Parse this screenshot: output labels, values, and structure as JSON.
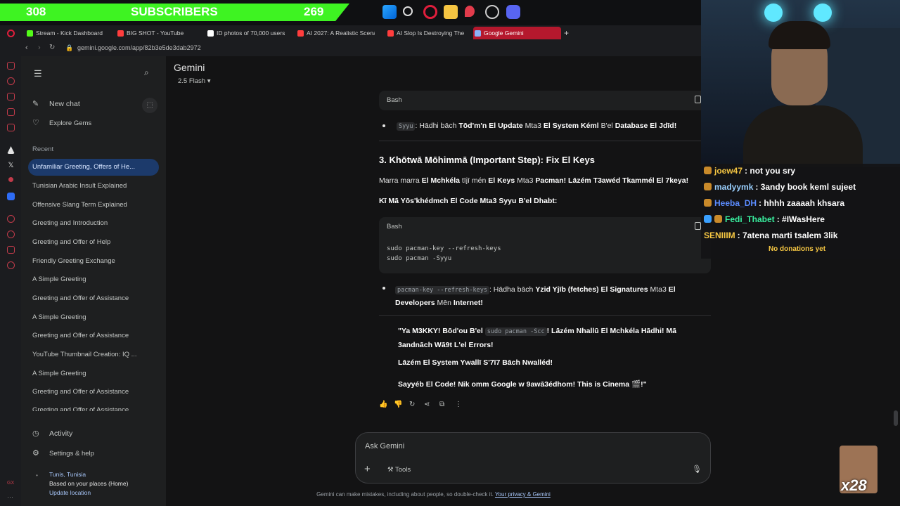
{
  "overlay": {
    "subscribers_left": "308",
    "subscribers_label": "SUBSCRIBERS",
    "subscribers_right": "269",
    "chat": [
      {
        "user": "joew47",
        "message": ": not you sry",
        "color": "#f6c743"
      },
      {
        "user": "madyymk",
        "message": ": 3andy book keml sujeet",
        "color": "#9ad0ff"
      },
      {
        "user": "Heeba_DH",
        "message": ": hhhh zaaaah khsara",
        "color": "#5b8cff"
      },
      {
        "user": "Fedi_Thabet",
        "message": ": #IWasHere",
        "color": "#39f0a0"
      },
      {
        "user": "SENIIIM",
        "message": ": 7atena marti tsalem 3lik",
        "color": "#f6c743"
      }
    ],
    "no_donations": "No donations yet",
    "emote_multiplier": "x28"
  },
  "browser": {
    "tabs": [
      {
        "label": "Stream - Kick Dashboard",
        "color": "#53fc18"
      },
      {
        "label": "BIG SHOT - YouTube",
        "color": "#ff3d3d"
      },
      {
        "label": "ID photos of 70,000 users",
        "color": "#ffffff"
      },
      {
        "label": "AI 2027: A Realistic Scena",
        "color": "#ff3d3d"
      },
      {
        "label": "AI Slop Is Destroying The",
        "color": "#ff3d3d"
      },
      {
        "label": "Google Gemini",
        "color": "#ffffff"
      }
    ],
    "url": "gemini.google.com/app/82b3e5de3dab2972"
  },
  "sidebar": {
    "new_chat": "New chat",
    "explore_gems": "Explore Gems",
    "recent_title": "Recent",
    "recent": [
      "Unfamiliar Greeting, Offers of He...",
      "Tunisian Arabic Insult Explained",
      "Offensive Slang Term Explained",
      "Greeting and Introduction",
      "Greeting and Offer of Help",
      "Friendly Greeting Exchange",
      "A Simple Greeting",
      "Greeting and Offer of Assistance",
      "A Simple Greeting",
      "Greeting and Offer of Assistance",
      "YouTube Thumbnail Creation: IQ ...",
      "A Simple Greeting",
      "Greeting and Offer of Assistance",
      "Greeting and Offer of Assistance"
    ],
    "activity": "Activity",
    "settings": "Settings & help",
    "location": "Tunis, Tunisia",
    "location_basis": "Based on your places (Home)",
    "update_location": "Update location"
  },
  "main": {
    "title": "Gemini",
    "model": "2.5 Flash",
    "code1_lang": "Bash",
    "bullet1_code": "Syyu",
    "bullet1_pre": ": Hādhi bāch ",
    "bullet1_b1": "Tōd'm'n El Update",
    "bullet1_mid": " Mta3 ",
    "bullet1_b2": "El System Kéml",
    "bullet1_mid2": " B'el ",
    "bullet1_b3": "Database El Jdīd!",
    "heading": "3. Khōtwā Mōhimmā (Important Step): Fix El Keys",
    "para1_pre": "Marra marra ",
    "para1_b1": "El Mchkéla",
    "para1_mid": " tījī mén ",
    "para1_b2": "El Keys",
    "para1_mid2": " Mta3 ",
    "para1_b3": "Pacman! Lāzém T3awéd Tkammél El 7keya!",
    "para2": "Kī Mā Yōs'khédmch El Code Mta3 Syyu B'el Dhabt:",
    "code2_lang": "Bash",
    "code2_line1": "sudo pacman-key --refresh-keys",
    "code2_line2": "sudo pacman -Syyu",
    "bullet2_code": "pacman-key --refresh-keys",
    "bullet2_pre": ": Hādha bāch ",
    "bullet2_b1": "Yzid Yjīb (fetches) El Signatures",
    "bullet2_mid": " Mta3 ",
    "bullet2_b2": "El Developers",
    "bullet2_mid2": " Mēn ",
    "bullet2_b3": "Internet!",
    "quote1_pre": "\"Ya M3KKY! Bōd'ou B'el ",
    "quote1_code": "sudo pacman -Scc",
    "quote1_post": "! Lāzém Nhallū El Mchkéla Hādhi! Mā 3andnāch Wā9t L'el Errors!",
    "quote2": "Lāzém El System Ywallī S'7ī7 Bāch Nwalléd!",
    "quote3": "Sayyéb El Code! Nik omm Google w 9awā3édhom! This is Cinema 🎬!\"",
    "input_placeholder": "Ask Gemini",
    "tools_label": "Tools",
    "disclaimer": "Gemini can make mistakes, including about people, so double-check it. ",
    "privacy_link": "Your privacy & Gemini"
  }
}
